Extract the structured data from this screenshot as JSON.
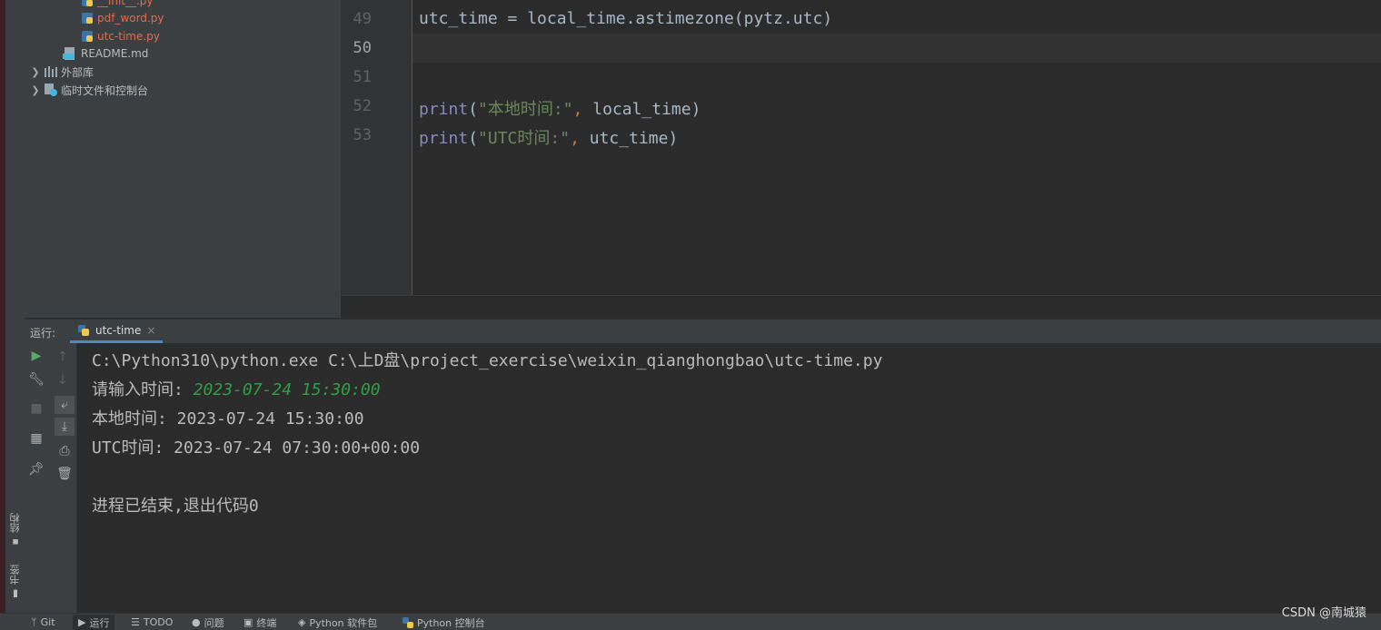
{
  "project_tree": {
    "items": [
      {
        "name": "__init__.py",
        "kind": "py",
        "color": "red"
      },
      {
        "name": "pdf_word.py",
        "kind": "py",
        "color": "red"
      },
      {
        "name": "utc-time.py",
        "kind": "py",
        "color": "red"
      },
      {
        "name": "README.md",
        "kind": "md",
        "color": "normal"
      },
      {
        "name": "外部库",
        "kind": "lib",
        "color": "normal"
      },
      {
        "name": "临时文件和控制台",
        "kind": "scratch",
        "color": "normal"
      }
    ]
  },
  "editor": {
    "lines": [
      {
        "num": "49",
        "tokens": [
          {
            "t": "utc_time = local_time.astimezone(pytz.utc)",
            "c": "plain"
          }
        ]
      },
      {
        "num": "50",
        "tokens": []
      },
      {
        "num": "51",
        "tokens": []
      },
      {
        "num": "52",
        "tokens": [
          {
            "t": "print",
            "c": "fn"
          },
          {
            "t": "(",
            "c": "plain"
          },
          {
            "t": "\"本地时间:\"",
            "c": "str"
          },
          {
            "t": ",",
            "c": "punc"
          },
          {
            "t": " local_time)",
            "c": "plain"
          }
        ]
      },
      {
        "num": "53",
        "tokens": [
          {
            "t": "print",
            "c": "fn"
          },
          {
            "t": "(",
            "c": "plain"
          },
          {
            "t": "\"UTC时间:\"",
            "c": "str"
          },
          {
            "t": ",",
            "c": "punc"
          },
          {
            "t": " utc_time)",
            "c": "plain"
          }
        ]
      }
    ],
    "current_line": "50"
  },
  "run_panel": {
    "label": "运行:",
    "tab_label": "utc-time",
    "tab_close": "×",
    "console": {
      "command": "C:\\Python310\\python.exe C:\\上D盘\\project_exercise\\weixin_qianghongbao\\utc-time.py",
      "prompt": "请输入时间: ",
      "user_input": "2023-07-24 15:30:00",
      "local_output": "本地时间: 2023-07-24 15:30:00",
      "utc_output": "UTC时间: 2023-07-24 07:30:00+00:00",
      "exit_message": "进程已结束,退出代码0"
    }
  },
  "side_tools": {
    "structure": "结构",
    "bookmarks": "书签"
  },
  "status_bar": {
    "items": [
      {
        "label": "Git",
        "icon": "git-branch-icon"
      },
      {
        "label": "运行",
        "icon": "run-icon",
        "active": true
      },
      {
        "label": "TODO",
        "icon": "todo-list-icon"
      },
      {
        "label": "问题",
        "icon": "problems-icon"
      },
      {
        "label": "终端",
        "icon": "terminal-icon"
      },
      {
        "label": "Python 软件包",
        "icon": "packages-icon"
      },
      {
        "label": "Python 控制台",
        "icon": "python-icon"
      }
    ]
  },
  "watermark": "CSDN @南城猿",
  "colors": {
    "editor_bg": "#2b2b2b",
    "panel_bg": "#3c3f41",
    "string": "#6a8759",
    "builtin": "#8888c6",
    "input_green": "#2ea043",
    "modified_file": "#e06c4c",
    "accent": "#4a88c7"
  }
}
